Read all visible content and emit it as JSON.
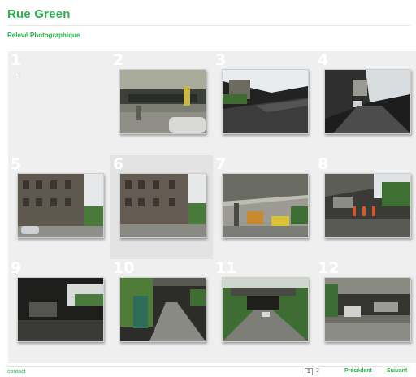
{
  "header": {
    "title": "Rue Green",
    "subtitle": "Relevé Photographique"
  },
  "gallery": {
    "items": [
      {
        "num": "1"
      },
      {
        "num": "2"
      },
      {
        "num": "3"
      },
      {
        "num": "4"
      },
      {
        "num": "5"
      },
      {
        "num": "6"
      },
      {
        "num": "7"
      },
      {
        "num": "8"
      },
      {
        "num": "9"
      },
      {
        "num": "10"
      },
      {
        "num": "11"
      },
      {
        "num": "12"
      }
    ],
    "cursor_icon": "text-cursor-icon"
  },
  "footer": {
    "contact": "contact",
    "pages": [
      "1",
      "2"
    ],
    "prev": "Précédent",
    "next": "Suivant"
  },
  "colors": {
    "accent": "#2bb24c",
    "grid_bg": "#efefef"
  }
}
